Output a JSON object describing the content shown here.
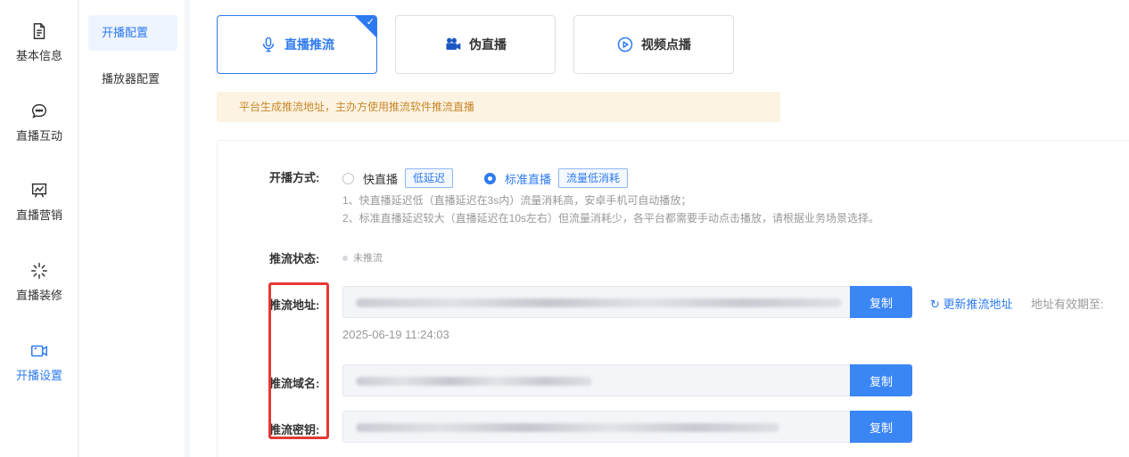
{
  "left_nav": [
    {
      "label": "基本信息",
      "icon": "document-icon"
    },
    {
      "label": "直播互动",
      "icon": "chat-icon"
    },
    {
      "label": "直播营销",
      "icon": "chart-board-icon"
    },
    {
      "label": "直播装修",
      "icon": "sparkle-icon"
    },
    {
      "label": "开播设置",
      "icon": "video-camera-icon",
      "active": true
    }
  ],
  "sub_nav": [
    {
      "label": "开播配置",
      "active": true
    },
    {
      "label": "播放器配置"
    }
  ],
  "modes": [
    {
      "label": "直播推流",
      "icon": "microphone-icon",
      "active": true
    },
    {
      "label": "伪直播",
      "icon": "camera-icon"
    },
    {
      "label": "视频点播",
      "icon": "play-circle-icon"
    }
  ],
  "notice": "平台生成推流地址，主办方使用推流软件推流直播",
  "broadcast_mode": {
    "label": "开播方式:",
    "options": [
      {
        "label": "快直播",
        "tag": "低延迟",
        "checked": false
      },
      {
        "label": "标准直播",
        "tag": "流量低消耗",
        "checked": true
      }
    ],
    "hint1": "1、快直播延迟低（直播延迟在3s内）流量消耗高，安卓手机可自动播放；",
    "hint2": "2、标准直播延迟较大（直播延迟在10s左右）但流量消耗少，各平台都需要手动点击播放，请根据业务场景选择。"
  },
  "push_status": {
    "label": "推流状态:",
    "value": "未推流"
  },
  "push_url": {
    "label": "推流地址:",
    "copy": "复制",
    "refresh": "更新推流地址",
    "expire_label": "地址有效期至:",
    "date": "2025-06-19 11:24:03"
  },
  "push_domain": {
    "label": "推流域名:",
    "copy": "复制"
  },
  "push_key": {
    "label": "推流密钥:",
    "copy": "复制"
  },
  "colors": {
    "accent": "#2d7af0",
    "highlight_box": "#e53935",
    "notice_bg": "#fdf3e2"
  }
}
